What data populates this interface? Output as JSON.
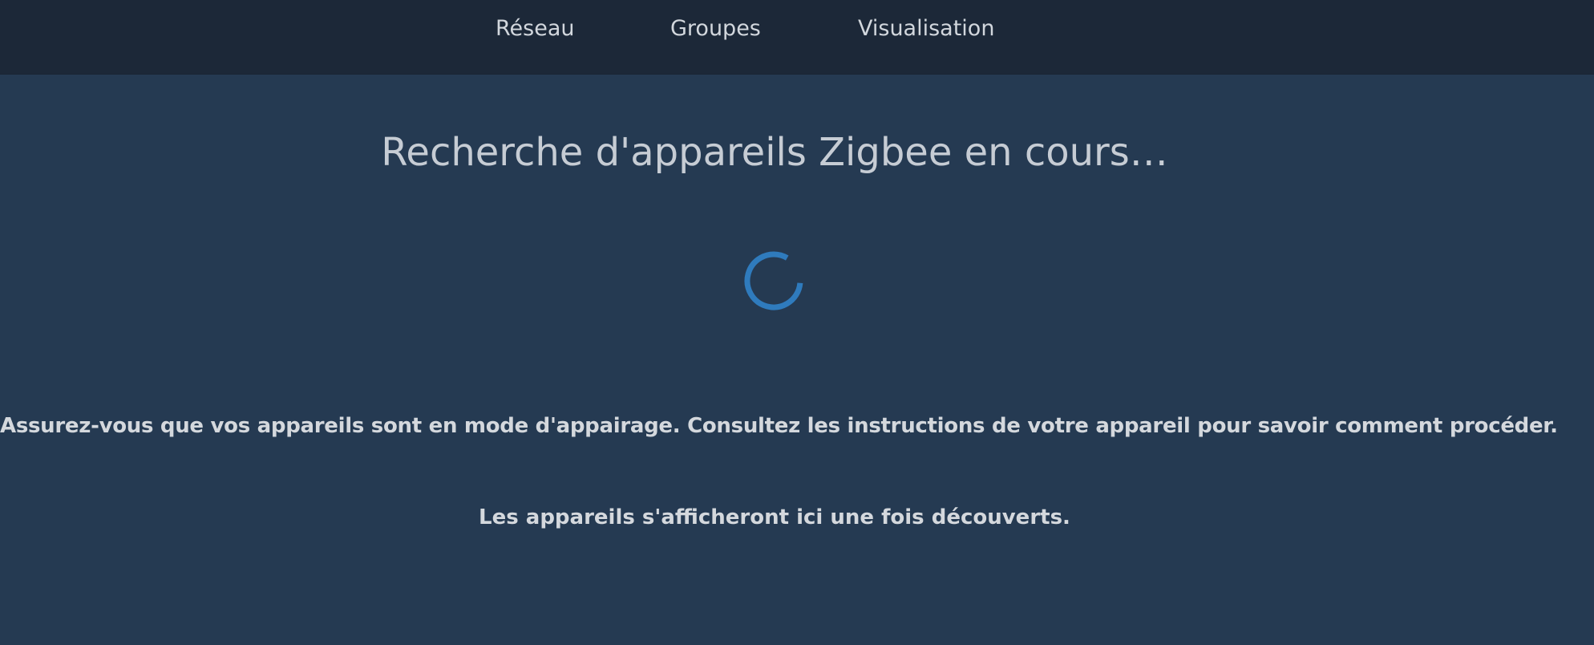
{
  "nav": {
    "items": [
      {
        "label": "Réseau"
      },
      {
        "label": "Groupes"
      },
      {
        "label": "Visualisation"
      }
    ]
  },
  "main": {
    "title": "Recherche d'appareils Zigbee en cours…",
    "spinner_icon": "loading-spinner-icon",
    "instruction": "Assurez-vous que vos appareils sont en mode d'appairage. Consultez les instructions de votre appareil pour savoir comment procéder.",
    "note": "Les appareils s'afficheront ici une fois découverts."
  },
  "colors": {
    "background": "#253a52",
    "topbar": "#1c2838",
    "accent": "#2f7bbd",
    "text": "#d4d8dd"
  }
}
